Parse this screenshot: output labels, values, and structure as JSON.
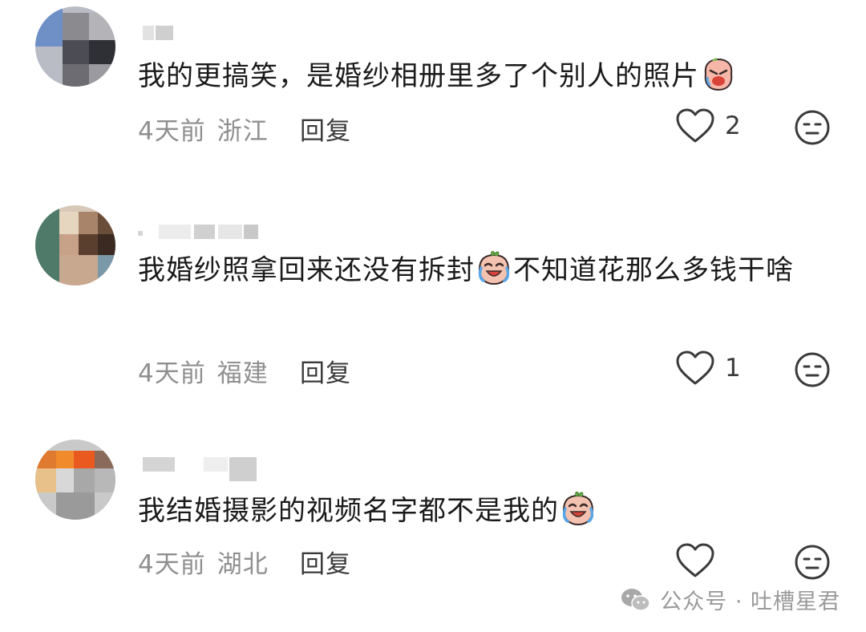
{
  "comments": [
    {
      "text_before": "我的更搞笑，是婚纱相册里多了个别人的照片",
      "text_after": "",
      "emoji": "crying-face-emoji",
      "time": "4天前",
      "location": "浙江",
      "reply_label": "回复",
      "like_count": "2"
    },
    {
      "text_before": "我婚纱照拿回来还没有拆封",
      "text_after": "不知道花那么多钱干啥",
      "emoji": "laugh-cry-emoji",
      "time": "4天前",
      "location": "福建",
      "reply_label": "回复",
      "like_count": "1"
    },
    {
      "text_before": "我结婚摄影的视频名字都不是我的",
      "text_after": "",
      "emoji": "laugh-cry-emoji",
      "time": "4天前",
      "location": "湖北",
      "reply_label": "回复",
      "like_count": ""
    }
  ],
  "watermark": {
    "icon": "wechat-icon",
    "text": "公众号 · 吐槽星君"
  },
  "colors": {
    "text": "#1a1a1a",
    "meta": "#8f8f8f",
    "icon": "#3a3a3a"
  }
}
